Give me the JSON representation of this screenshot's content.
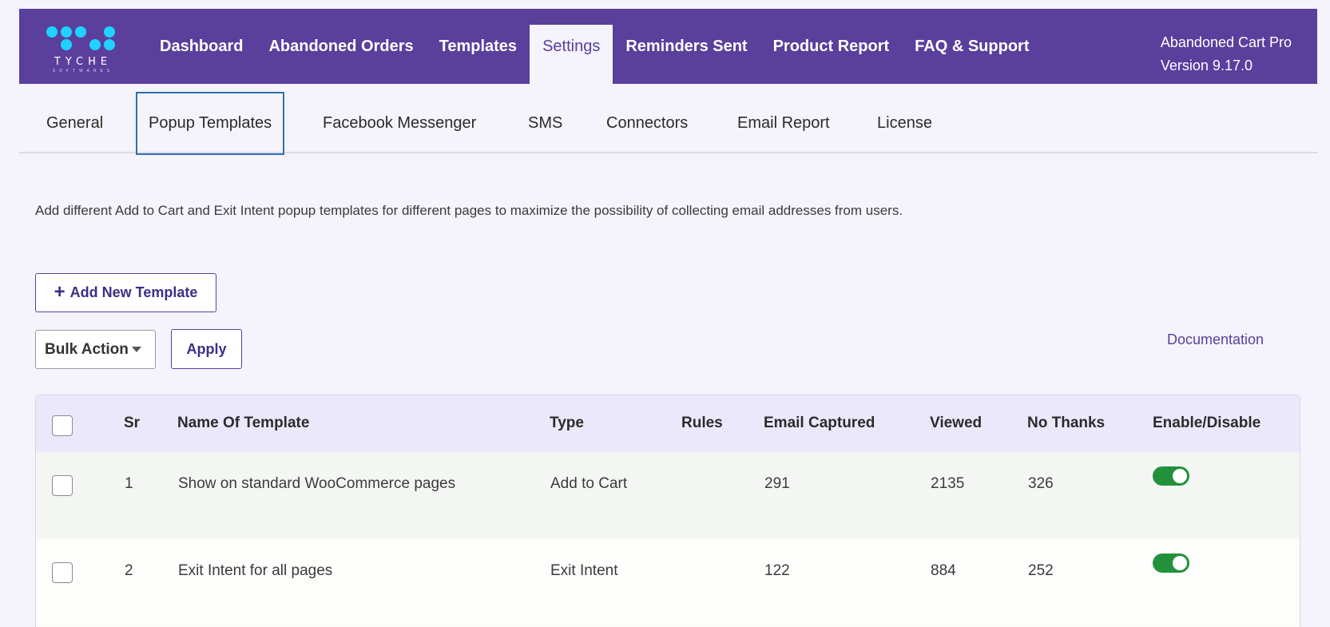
{
  "header": {
    "logo_text": "TYCHE",
    "logo_sub": "SOFTWARES",
    "nav": [
      {
        "label": "Dashboard"
      },
      {
        "label": "Abandoned Orders"
      },
      {
        "label": "Templates"
      },
      {
        "label": "Settings"
      },
      {
        "label": "Reminders Sent"
      },
      {
        "label": "Product Report"
      },
      {
        "label": "FAQ & Support"
      }
    ],
    "version_line1": "Abandoned Cart Pro",
    "version_line2": "Version 9.17.0",
    "colors": {
      "bar": "#5a3f9c",
      "logo_dots": "#1fd2ff"
    }
  },
  "subtabs": [
    {
      "label": "General"
    },
    {
      "label": "Popup Templates"
    },
    {
      "label": "Facebook Messenger"
    },
    {
      "label": "SMS"
    },
    {
      "label": "Connectors"
    },
    {
      "label": "Email Report"
    },
    {
      "label": "License"
    }
  ],
  "description": "Add different Add to Cart and Exit Intent popup templates for different pages to maximize the possibility of collecting email addresses from users.",
  "actions": {
    "add_icon": "plus-icon",
    "add_label": "Add New Template",
    "bulk_label": "Bulk Action",
    "apply_label": "Apply",
    "doc_label": "Documentation"
  },
  "table": {
    "headers": [
      "Sr",
      "Name Of Template",
      "Type",
      "Rules",
      "Email Captured",
      "Viewed",
      "No Thanks",
      "Enable/Disable"
    ],
    "rows": [
      {
        "sr": "1",
        "name": "Show on standard WooCommerce pages",
        "type": "Add to Cart",
        "rules": "",
        "email": "291",
        "viewed": "2135",
        "nothanks": "326",
        "enabled": true
      },
      {
        "sr": "2",
        "name": "Exit Intent for all pages",
        "type": "Exit Intent",
        "rules": "",
        "email": "122",
        "viewed": "884",
        "nothanks": "252",
        "enabled": true
      }
    ],
    "toggle_color": "#23913b"
  }
}
